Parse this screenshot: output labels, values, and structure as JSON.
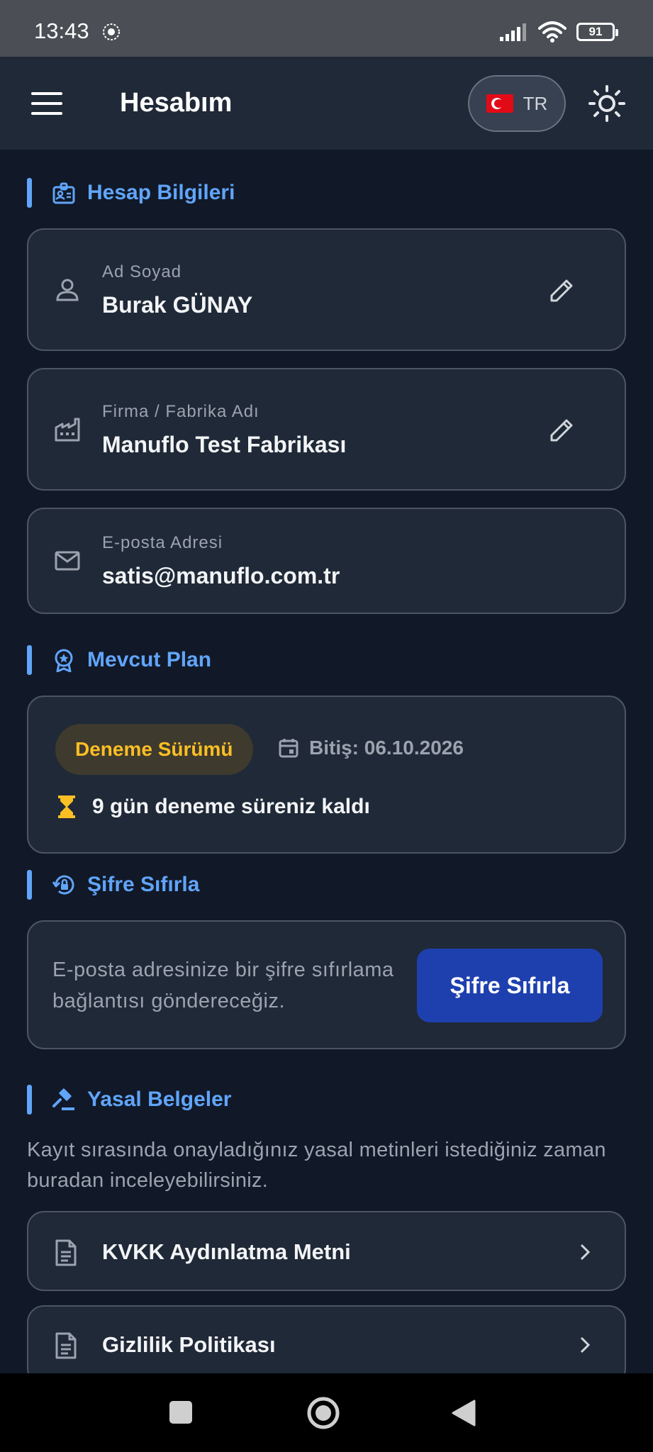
{
  "status_bar": {
    "time": "13:43",
    "battery": "91"
  },
  "app_bar": {
    "title": "Hesabım",
    "language": "TR"
  },
  "account": {
    "section_title": "Hesap Bilgileri",
    "name": {
      "label": "Ad Soyad",
      "value": "Burak GÜNAY"
    },
    "company": {
      "label": "Firma / Fabrika Adı",
      "value": "Manuflo Test Fabrikası"
    },
    "email": {
      "label": "E-posta Adresi",
      "value": "satis@manuflo.com.tr"
    }
  },
  "plan": {
    "section_title": "Mevcut Plan",
    "badge": "Deneme Sürümü",
    "expiry": "Bitiş: 06.10.2026",
    "remaining": "9 gün deneme süreniz kaldı"
  },
  "password_reset": {
    "section_title": "Şifre Sıfırla",
    "description": "E-posta adresinize bir şifre sıfırlama bağlantısı göndereceğiz.",
    "button": "Şifre Sıfırla"
  },
  "legal": {
    "section_title": "Yasal Belgeler",
    "description": "Kayıt sırasında onayladığınız yasal metinleri istediğiniz zaman buradan inceleyebilirsiniz.",
    "items": [
      {
        "label": "KVKK Aydınlatma Metni"
      },
      {
        "label": "Gizlilik Politikası"
      }
    ]
  },
  "colors": {
    "accent": "#60a5fa",
    "background": "#111827",
    "card": "#1f2937",
    "badge_text": "#fbbf24",
    "primary_button": "#1e40af"
  }
}
